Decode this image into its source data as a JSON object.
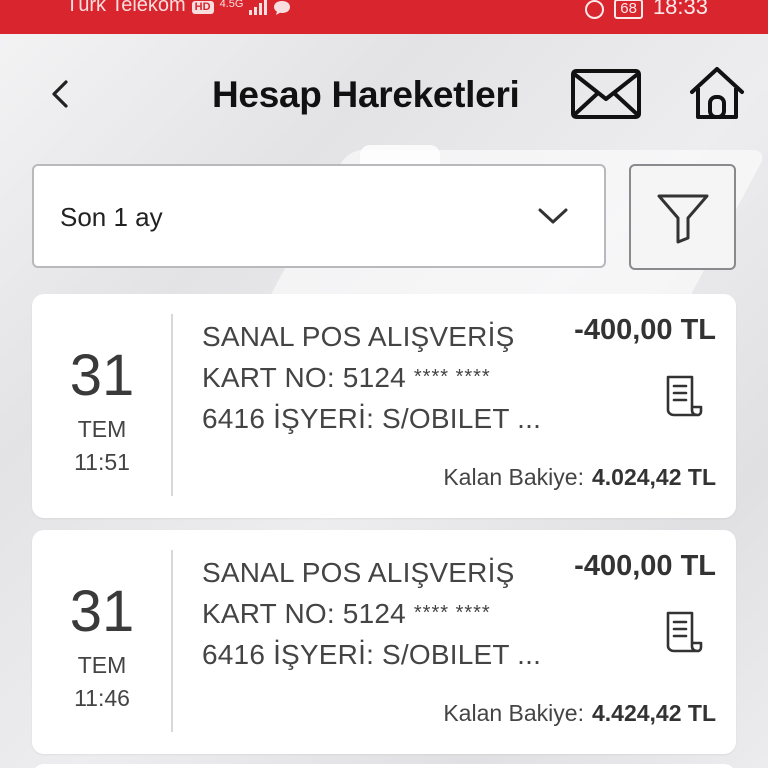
{
  "status_bar": {
    "carrier": "Türk Telekom",
    "network_badge": "HD",
    "network_type": "4.5G",
    "battery": "68",
    "time": "18:33"
  },
  "header": {
    "title": "Hesap Hareketleri",
    "back_icon": "chevron-left-icon",
    "mail_icon": "envelope-icon",
    "home_icon": "home-icon"
  },
  "filter": {
    "period_value": "Son 1 ay",
    "filter_icon": "funnel-icon"
  },
  "transactions": [
    {
      "day": "31",
      "month": "TEM",
      "time": "11:51",
      "line1": "SANAL POS ALIŞVERİŞ",
      "line2_prefix": "KART NO: 5124",
      "line2_mask": "**** ****",
      "line3": "6416 İŞYERİ: S/OBILET ...",
      "amount": "-400,00 TL",
      "balance_label": "Kalan Bakiye:",
      "balance_value": "4.024,42 TL"
    },
    {
      "day": "31",
      "month": "TEM",
      "time": "11:46",
      "line1": "SANAL POS ALIŞVERİŞ",
      "line2_prefix": "KART NO: 5124",
      "line2_mask": "**** ****",
      "line3": "6416 İŞYERİ: S/OBILET ...",
      "amount": "-400,00 TL",
      "balance_label": "Kalan Bakiye:",
      "balance_value": "4.424,42 TL"
    }
  ],
  "colors": {
    "brand_red": "#d9262e",
    "text_dark": "#111111",
    "card_bg": "#ffffff"
  }
}
